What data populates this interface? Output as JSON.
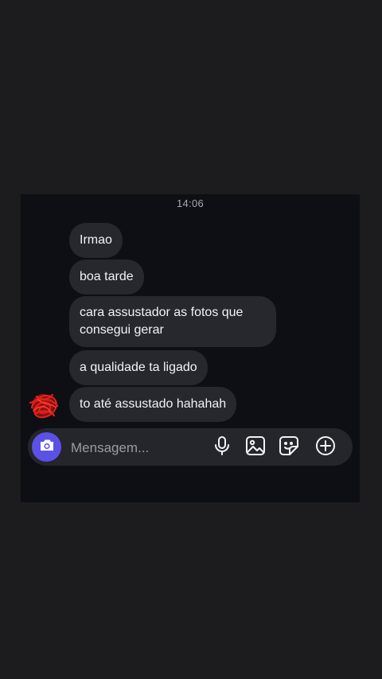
{
  "chat": {
    "timestamp": "14:06",
    "messages": [
      {
        "text": "Irmao"
      },
      {
        "text": "boa tarde"
      },
      {
        "text": "cara assustador as fotos que consegui gerar"
      },
      {
        "text": "a qualidade ta ligado"
      },
      {
        "text": "to até assustado hahahah"
      }
    ]
  },
  "composer": {
    "placeholder": "Mensagem...",
    "icons": [
      "camera-icon",
      "microphone-icon",
      "image-icon",
      "sticker-icon",
      "plus-circle-icon"
    ]
  },
  "colors": {
    "page_background": "#1c1c1e",
    "chat_background": "#0d0f14",
    "bubble": "#26282e",
    "accent": "#5b51e6",
    "avatar_scribble": "#e0201c"
  }
}
